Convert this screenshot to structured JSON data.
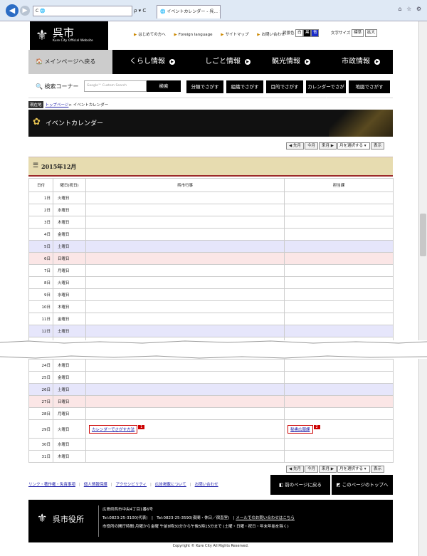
{
  "browser": {
    "address": "C 🌐",
    "address_tools": "ρ ▾ C",
    "tab_title": "🌐 イベントカレンダー - 呉... ✕",
    "window_tools": "⌂ ☆ ⚙"
  },
  "header": {
    "logo_mark": "⚜",
    "logo_name": "呉市",
    "logo_sub": "Kure City Official Website",
    "toplinks": [
      "はじめての方へ",
      "Foreign language",
      "サイトマップ",
      "お問い合わせ"
    ],
    "bgcolor_label": "背景色",
    "bgcolor_options": [
      "白",
      "黒",
      "青"
    ],
    "textsize_label": "文字サイズ",
    "textsize_options": [
      "標準",
      "拡大"
    ]
  },
  "nav": {
    "home": "メインページへ戻る",
    "items": [
      "くらし情報",
      "しごと情報",
      "観光情報",
      "市政情報"
    ]
  },
  "search": {
    "label": "検索コーナー",
    "placeholder": "Google™ Custom Search",
    "button": "検索",
    "find_buttons": [
      "分類でさがす",
      "組織でさがす",
      "目的でさがす",
      "カレンダーでさがす",
      "地図でさがす"
    ]
  },
  "breadcrumb": {
    "label": "現在地",
    "home": "トップページ",
    "current": "> イベントカレンダー"
  },
  "page_title": "イベントカレンダー",
  "month_nav": {
    "prev": "◀ 先月",
    "current": "今月",
    "next": "来月 ▶",
    "select": "月を選択する ▾",
    "show": "表示"
  },
  "calendar": {
    "month": "2015年12月",
    "headers": [
      "日付",
      "曜日(祝日)",
      "呉市行事",
      "担当課"
    ],
    "rows_top": [
      {
        "day": "1日",
        "weekday": "火曜日"
      },
      {
        "day": "2日",
        "weekday": "水曜日"
      },
      {
        "day": "3日",
        "weekday": "木曜日"
      },
      {
        "day": "4日",
        "weekday": "金曜日"
      },
      {
        "day": "5日",
        "weekday": "土曜日"
      },
      {
        "day": "6日",
        "weekday": "日曜日"
      },
      {
        "day": "7日",
        "weekday": "月曜日"
      },
      {
        "day": "8日",
        "weekday": "火曜日"
      },
      {
        "day": "9日",
        "weekday": "水曜日"
      },
      {
        "day": "10日",
        "weekday": "木曜日"
      },
      {
        "day": "11日",
        "weekday": "金曜日"
      },
      {
        "day": "12日",
        "weekday": "土曜日"
      }
    ],
    "rows_bottom": [
      {
        "day": "24日",
        "weekday": "木曜日"
      },
      {
        "day": "25日",
        "weekday": "金曜日"
      },
      {
        "day": "26日",
        "weekday": "土曜日"
      },
      {
        "day": "27日",
        "weekday": "日曜日"
      },
      {
        "day": "28日",
        "weekday": "月曜日"
      },
      {
        "day": "29日",
        "weekday": "火曜日"
      },
      {
        "day": "30日",
        "weekday": "水曜日"
      },
      {
        "day": "31日",
        "weekday": "木曜日"
      }
    ],
    "event_29": {
      "title": "カレンダーでさがす方法",
      "num1": "1",
      "dept": "秘書広報課",
      "num2": "2"
    }
  },
  "footer": {
    "links": [
      "リンク・著作権・免責事項",
      "個人情報保護",
      "アクセシビリティ",
      "広告掲載について",
      "お問い合わせ"
    ],
    "prev_page": "前のページに戻る",
    "top_page": "このページのトップへ",
    "org_mark": "⚜",
    "org_name": "呉市役所",
    "address": "広島県呉市中央4丁目1番6号",
    "tel": "Tel:0823-25-3100(代表)　|　Tel:0823-25-3590(夜間・休日／宿直室)　|",
    "mail": "メールでのお問い合わせはこちら",
    "hours": "市役所の開庁時間:月曜から金曜 午前8時30分から午後5時15分まで (土曜・日曜・祝日・年末年始を除く)",
    "copyright": "Copyright © Kure City All Rights Reserved."
  }
}
